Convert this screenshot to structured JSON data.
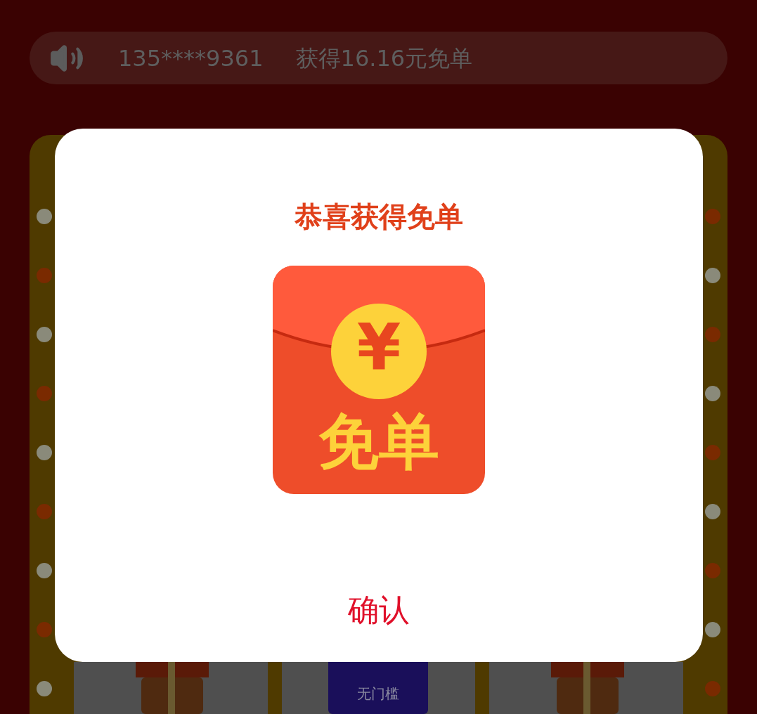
{
  "ticker": {
    "phone": "135****9361",
    "message": "获得16.16元免单"
  },
  "dialog": {
    "title": "恭喜获得免单",
    "icon_symbol": "¥",
    "icon_label": "免单",
    "confirm": "确认"
  },
  "prizes": [
    {
      "kind": "gift"
    },
    {
      "kind": "coupon",
      "condition": "无门槛"
    },
    {
      "kind": "gift"
    }
  ]
}
